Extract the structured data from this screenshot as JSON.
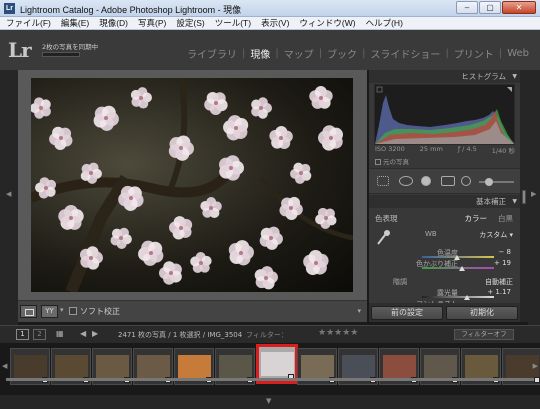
{
  "window": {
    "title": "Lightroom Catalog - Adobe Photoshop Lightroom - 現像",
    "app_icon": "Lr",
    "minimize": "–",
    "maximize": "▢",
    "close": "✕"
  },
  "menu": [
    "ファイル(F)",
    "編集(E)",
    "現像(D)",
    "写真(P)",
    "設定(S)",
    "ツール(T)",
    "表示(V)",
    "ウィンドウ(W)",
    "ヘルプ(H)"
  ],
  "header": {
    "logo": "Lr",
    "sync_text": "2枚の写真を同期中"
  },
  "modules": [
    {
      "label": "ライブラリ",
      "active": false
    },
    {
      "label": "現像",
      "active": true
    },
    {
      "label": "マップ",
      "active": false
    },
    {
      "label": "ブック",
      "active": false
    },
    {
      "label": "スライドショー",
      "active": false
    },
    {
      "label": "プリント",
      "active": false
    },
    {
      "label": "Web",
      "active": false
    }
  ],
  "toolbar": {
    "soft_proof": "ソフト校正",
    "yy": "YY"
  },
  "histogram": {
    "title": "ヒストグラム",
    "iso": "ISO 3200",
    "focal": "25 mm",
    "aperture": "ƒ / 4.5",
    "shutter": "1/40 秒",
    "original_photo": "元の写真"
  },
  "basic": {
    "title": "基本補正",
    "treatment_label": "色表現",
    "color": "カラー",
    "bw": "白黒",
    "wb_label": "WB",
    "wb_value": "カスタム",
    "temp_label": "色温度",
    "temp_value": "− 8",
    "tint_label": "色かぶり補正",
    "tint_value": "+ 19",
    "tone_label": "階調",
    "auto_label": "自動補正",
    "exposure_label": "露光量",
    "exposure_value": "+ 1.17",
    "contrast_label": "コントラスト",
    "temp_pos": 0.48,
    "tint_pos": 0.55,
    "exposure_pos": 0.62
  },
  "buttons": {
    "previous": "前の設定",
    "reset": "初期化"
  },
  "filmstrip_bar": {
    "page1": "1",
    "page2": "2",
    "info": "2471 枚の写真 / 1 枚選択 / IMG_3504",
    "filter_label": "フィルター：",
    "stars": "★★★★★",
    "filter_off": "フィルターオフ"
  },
  "thumbs_selected_index": 6,
  "thumb_colors": [
    "#4a3c2c",
    "#5b4a33",
    "#6a5a44",
    "#6b5a45",
    "#c77b3a",
    "#5a5648",
    "#d8d4d6",
    "#7a6b56",
    "#4a4f57",
    "#8b4e3e",
    "#60584a",
    "#6a5a3d",
    "#4a3b2c"
  ]
}
